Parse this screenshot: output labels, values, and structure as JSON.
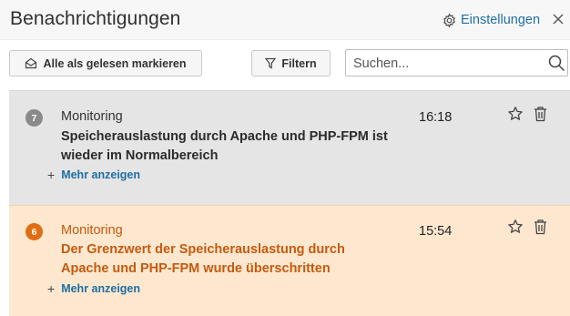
{
  "header": {
    "title": "Benachrichtigungen",
    "settings_label": "Einstellungen",
    "settings_icon": "gear-icon",
    "close_icon": "close-icon"
  },
  "toolbar": {
    "mark_all_label": "Alle als gelesen markieren",
    "mark_all_icon": "envelope-open-icon",
    "filter_label": "Filtern",
    "filter_icon": "funnel-icon",
    "search_placeholder": "Suchen...",
    "search_icon": "search-icon"
  },
  "notifications": [
    {
      "count": "7",
      "category": "Monitoring",
      "message": "Speicherauslastung durch Apache und PHP-FPM ist wieder im Normalbereich",
      "time": "16:18",
      "more_label": "Mehr anzeigen",
      "status": "resolved",
      "background": "#e5e5e5"
    },
    {
      "count": "6",
      "category": "Monitoring",
      "message": "Der Grenzwert der Speicherauslastung durch Apache und PHP-FPM wurde überschritten",
      "time": "15:54",
      "more_label": "Mehr anzeigen",
      "status": "warning",
      "background": "#fde8cf"
    }
  ],
  "colors": {
    "accent_link": "#1f6fa3",
    "warning_text": "#c55a0f",
    "warning_badge": "#e06d12",
    "neutral_badge": "#8a8a8a"
  }
}
